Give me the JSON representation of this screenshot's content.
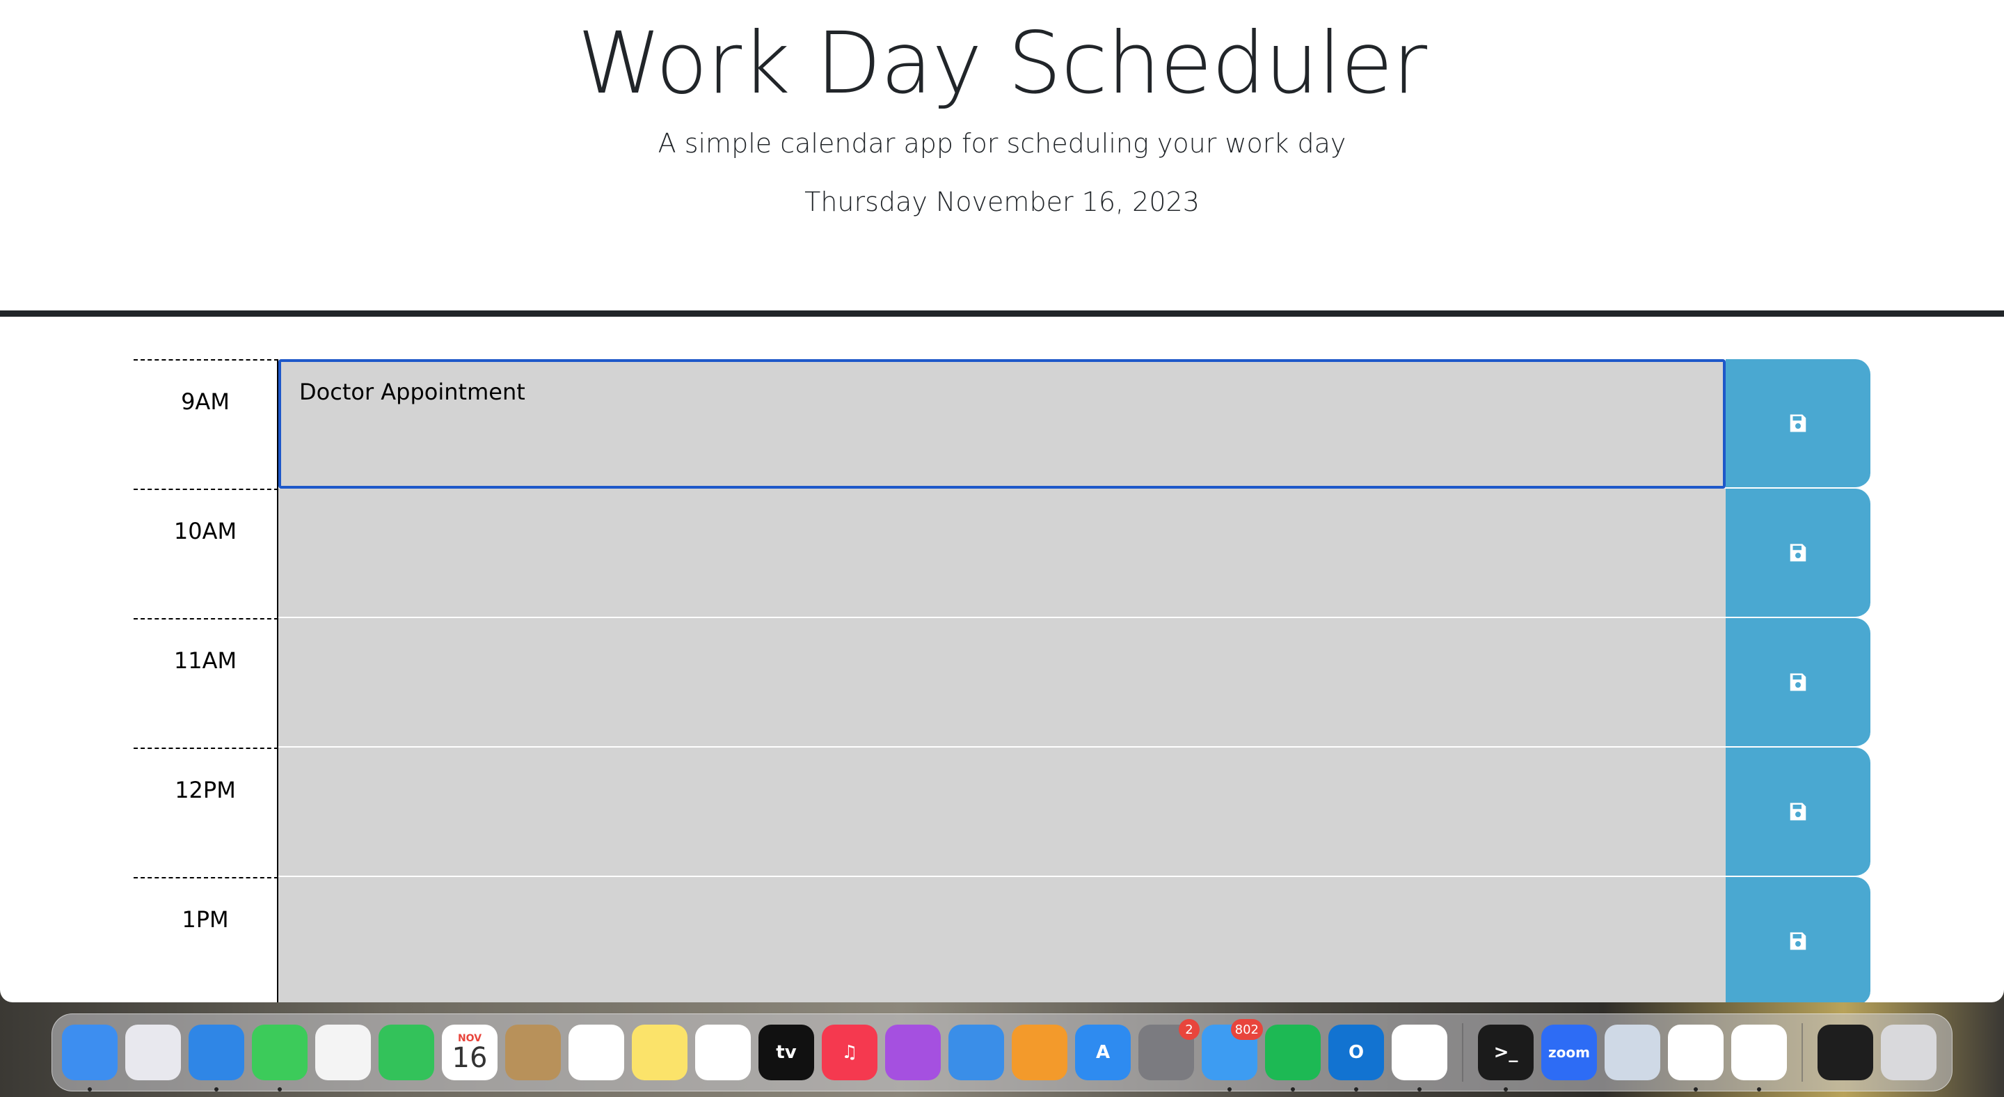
{
  "header": {
    "title": "Work Day Scheduler",
    "lead": "A simple calendar app for scheduling your work day",
    "current_day": "Thursday November 16, 2023"
  },
  "colors": {
    "past": "#d3d3d3",
    "save_button": "#4aa8d1",
    "focus_border": "#1e58c9"
  },
  "time_blocks": [
    {
      "hour": "9AM",
      "text": "Doctor Appointment",
      "state": "past",
      "save_icon": "floppy-disk-icon"
    },
    {
      "hour": "10AM",
      "text": "",
      "state": "past",
      "save_icon": "floppy-disk-icon"
    },
    {
      "hour": "11AM",
      "text": "",
      "state": "past",
      "save_icon": "floppy-disk-icon"
    },
    {
      "hour": "12PM",
      "text": "",
      "state": "past",
      "save_icon": "floppy-disk-icon"
    },
    {
      "hour": "1PM",
      "text": "",
      "state": "past",
      "save_icon": "floppy-disk-icon"
    }
  ],
  "dock": {
    "apps": [
      {
        "name": "finder-icon",
        "label": "",
        "color": "#3d8ef0",
        "running": true
      },
      {
        "name": "launchpad-icon",
        "label": "",
        "color": "#e8e8ee",
        "running": false
      },
      {
        "name": "safari-icon",
        "label": "",
        "color": "#2f86e6",
        "running": true
      },
      {
        "name": "messages-icon",
        "label": "",
        "color": "#3ccb5a",
        "running": true
      },
      {
        "name": "photos-icon",
        "label": "",
        "color": "#f4f4f4",
        "running": false
      },
      {
        "name": "facetime-icon",
        "label": "",
        "color": "#33c25a",
        "running": false
      },
      {
        "name": "calendar-icon",
        "label": "16",
        "month": "NOV",
        "color": "#ffffff",
        "running": false
      },
      {
        "name": "contacts-icon",
        "label": "",
        "color": "#b8915a",
        "running": false
      },
      {
        "name": "reminders-icon",
        "label": "",
        "color": "#ffffff",
        "running": false
      },
      {
        "name": "notes-icon",
        "label": "",
        "color": "#fbe36a",
        "running": false
      },
      {
        "name": "freeform-icon",
        "label": "",
        "color": "#ffffff",
        "running": false
      },
      {
        "name": "apple-tv-icon",
        "label": "tv",
        "color": "#111111",
        "running": false
      },
      {
        "name": "music-icon",
        "label": "♫",
        "color": "#f5394f",
        "running": false
      },
      {
        "name": "podcasts-icon",
        "label": "",
        "color": "#a550e0",
        "running": false
      },
      {
        "name": "keynote-icon",
        "label": "",
        "color": "#3a8ee8",
        "running": false
      },
      {
        "name": "pages-icon",
        "label": "",
        "color": "#f39a2b",
        "running": false
      },
      {
        "name": "app-store-icon",
        "label": "A",
        "color": "#2e8bf0",
        "running": false
      },
      {
        "name": "system-settings-icon",
        "label": "",
        "color": "#7b7b80",
        "running": false,
        "badge": "2"
      },
      {
        "name": "mail-icon",
        "label": "",
        "color": "#3d9cf2",
        "running": true,
        "badge": "802"
      },
      {
        "name": "spotify-icon",
        "label": "",
        "color": "#1db954",
        "running": true
      },
      {
        "name": "outlook-icon",
        "label": "O",
        "color": "#1273d1",
        "running": true
      },
      {
        "name": "chrome-icon",
        "label": "",
        "color": "#ffffff",
        "running": true
      },
      {
        "name": "terminal-icon",
        "label": ">_",
        "color": "#1b1b1b",
        "running": true
      },
      {
        "name": "zoom-icon",
        "label": "zoom",
        "color": "#2d6cf5",
        "running": false
      },
      {
        "name": "preview-icon",
        "label": "",
        "color": "#cfd9e6",
        "running": false
      },
      {
        "name": "slack-icon",
        "label": "",
        "color": "#ffffff",
        "running": true
      },
      {
        "name": "vscode-icon",
        "label": "",
        "color": "#ffffff",
        "running": true
      },
      {
        "name": "window-thumbnail-icon",
        "label": "",
        "color": "#1e1e1e",
        "running": false
      },
      {
        "name": "trash-icon",
        "label": "",
        "color": "#d9d9dc",
        "running": false
      }
    ]
  }
}
